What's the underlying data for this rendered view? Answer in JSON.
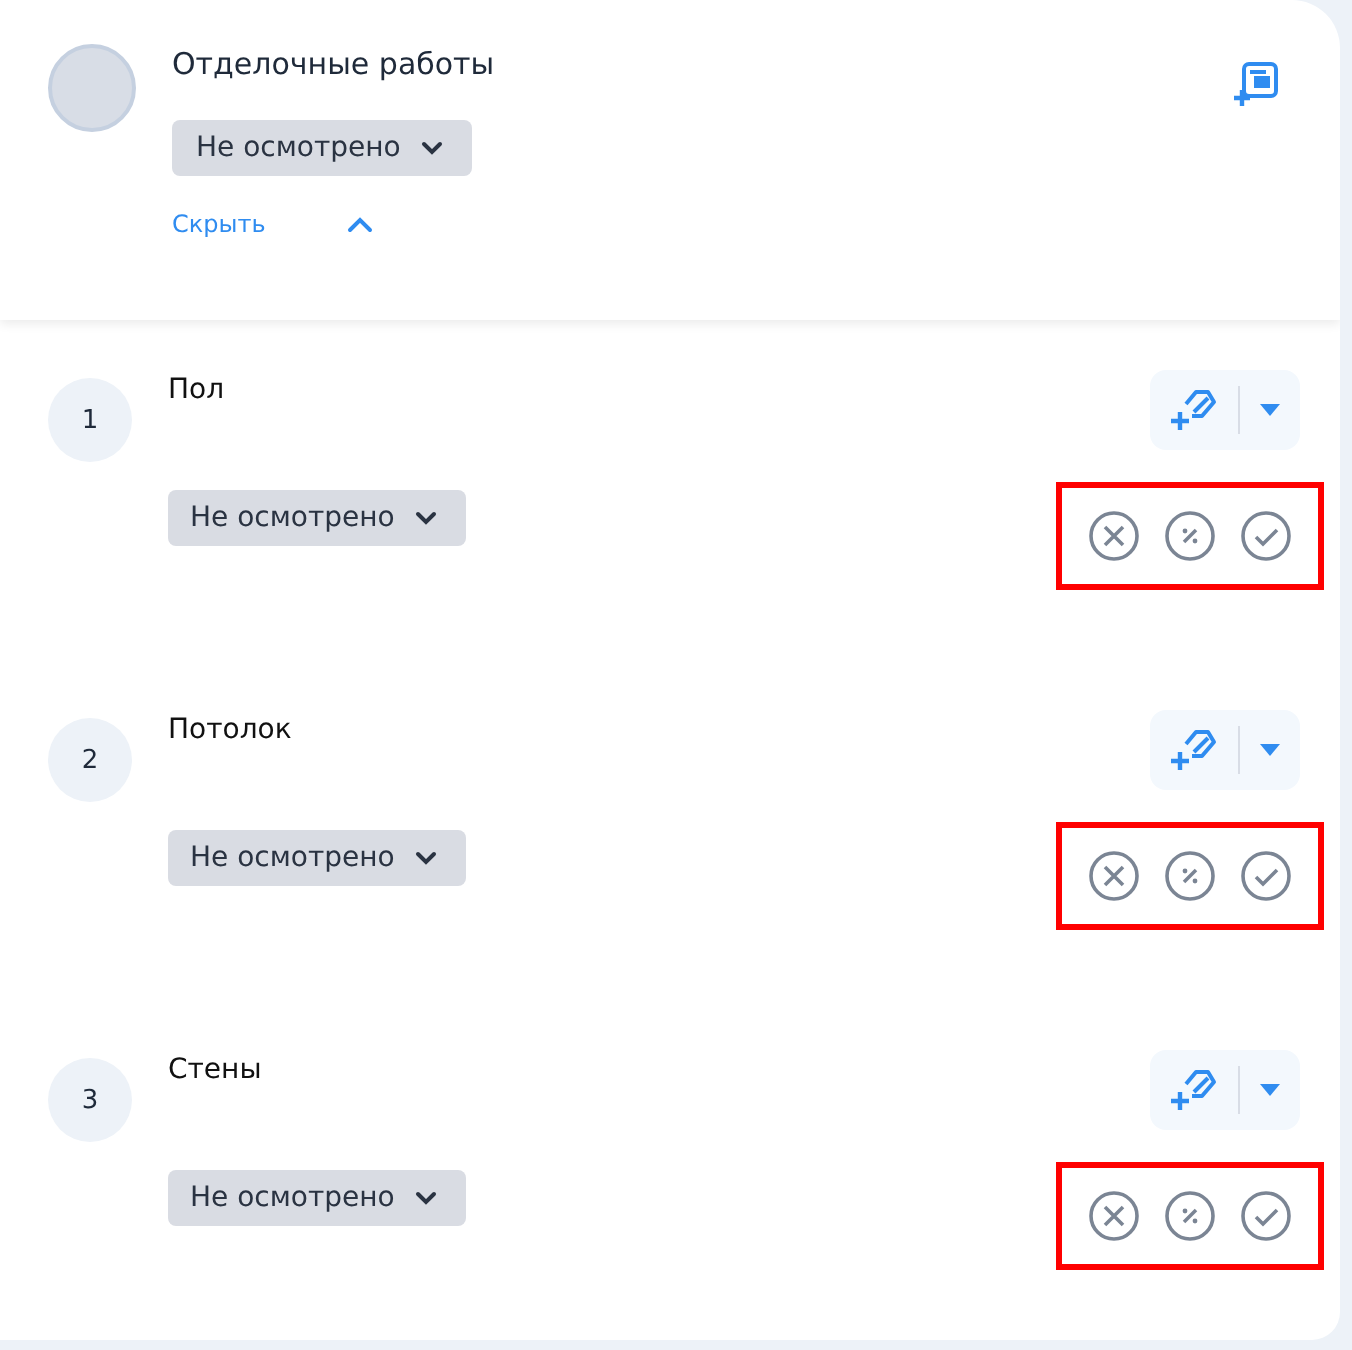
{
  "header": {
    "title": "Отделочные работы",
    "status": "Не осмотрено",
    "toggle_label": "Скрыть",
    "expanded": true
  },
  "items": [
    {
      "number": "1",
      "title": "Пол",
      "status": "Не осмотрено",
      "highlighted": true
    },
    {
      "number": "2",
      "title": "Потолок",
      "status": "Не осмотрено",
      "highlighted": true
    },
    {
      "number": "3",
      "title": "Стены",
      "status": "Не осмотрено",
      "highlighted": true
    }
  ]
}
